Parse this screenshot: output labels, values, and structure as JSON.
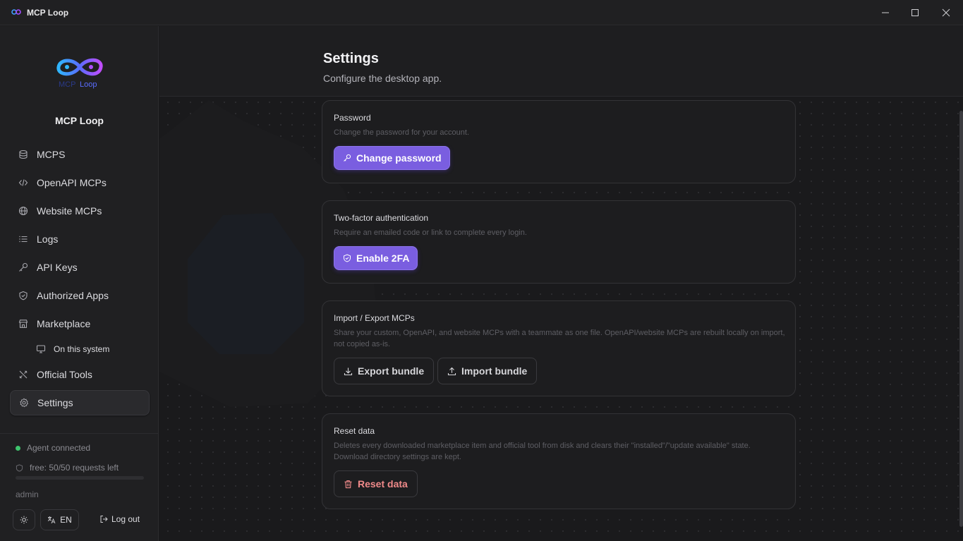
{
  "window": {
    "title": "MCP Loop"
  },
  "sidebar": {
    "logo_text_a": "MCP",
    "logo_text_b": "Loop",
    "brand_name": "MCP Loop",
    "items": [
      {
        "label": "MCPS",
        "icon": "database-icon"
      },
      {
        "label": "OpenAPI MCPs",
        "icon": "code-icon"
      },
      {
        "label": "Website MCPs",
        "icon": "globe-icon"
      },
      {
        "label": "Logs",
        "icon": "list-icon"
      },
      {
        "label": "API Keys",
        "icon": "key-icon"
      },
      {
        "label": "Authorized Apps",
        "icon": "shield-check-icon"
      },
      {
        "label": "Marketplace",
        "icon": "store-icon"
      },
      {
        "label": "On this system",
        "icon": "monitor-icon"
      },
      {
        "label": "Official Tools",
        "icon": "tools-icon"
      },
      {
        "label": "Settings",
        "icon": "gear-icon"
      }
    ],
    "active_item": "Settings",
    "agent_status": "Agent connected",
    "quota_text": "free: 50/50 requests left",
    "user": "admin",
    "language": "EN",
    "logout_label": "Log out"
  },
  "header": {
    "title": "Settings",
    "subtitle": "Configure the desktop app."
  },
  "cards": {
    "password": {
      "title": "Password",
      "description": "Change the password for your account.",
      "button": "Change password"
    },
    "twofa": {
      "title": "Two-factor authentication",
      "description": "Require an emailed code or link to complete every login.",
      "button": "Enable 2FA"
    },
    "import_export": {
      "title": "Import / Export MCPs",
      "description": "Share your custom, OpenAPI, and website MCPs with a teammate as one file. OpenAPI/website MCPs are rebuilt locally on import, not copied as-is.",
      "export_button": "Export bundle",
      "import_button": "Import bundle"
    },
    "reset": {
      "title": "Reset data",
      "description": "Deletes every downloaded marketplace item and official tool from disk and clears their \"installed\"/\"update available\" state. Download directory settings are kept.",
      "button": "Reset data"
    }
  },
  "colors": {
    "accent": "#7a5ee0",
    "status_ok": "#3ec46d",
    "danger": "#f08a8a"
  }
}
